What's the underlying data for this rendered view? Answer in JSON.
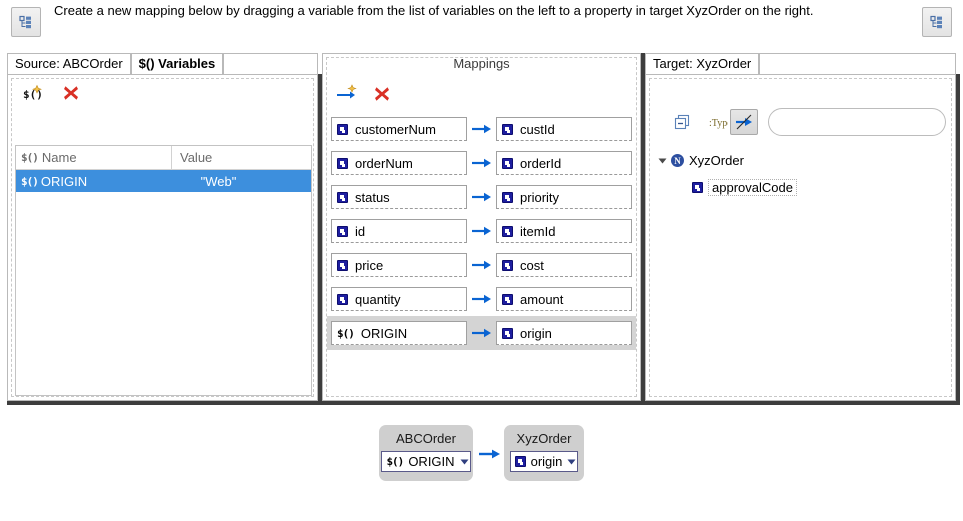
{
  "header": {
    "instruction": "Create a new mapping below by dragging a variable from the list of variables on the left to a property in target XyzOrder on the right.",
    "left_button_icon": "tree-outline-icon",
    "right_button_icon": "tree-outline-icon"
  },
  "source_panel": {
    "tabs": [
      {
        "label": "Source: ABCOrder",
        "active": false
      },
      {
        "label": "$() Variables",
        "active": true
      }
    ],
    "toolbar": {
      "add_variable_icon": "add-variable-icon",
      "delete_variable_icon": "delete-red-x-icon"
    },
    "table": {
      "columns": [
        "Name",
        "Value"
      ],
      "name_column_icon": "variable-icon",
      "rows": [
        {
          "icon": "variable-icon",
          "name": "ORIGIN",
          "value": "\"Web\"",
          "selected": true
        }
      ]
    }
  },
  "mappings_panel": {
    "title": "Mappings",
    "toolbar": {
      "add_mapping_icon": "add-mapping-arrow-icon",
      "delete_mapping_icon": "delete-red-x-icon"
    },
    "arrow_icon": "right-arrow-icon",
    "rows": [
      {
        "source_icon": "property-icon",
        "source": "customerNum",
        "target_icon": "property-icon",
        "target": "custId",
        "selected": false
      },
      {
        "source_icon": "property-icon",
        "source": "orderNum",
        "target_icon": "property-icon",
        "target": "orderId",
        "selected": false
      },
      {
        "source_icon": "property-icon",
        "source": "status",
        "target_icon": "property-icon",
        "target": "priority",
        "selected": false
      },
      {
        "source_icon": "property-icon",
        "source": "id",
        "target_icon": "property-icon",
        "target": "itemId",
        "selected": false
      },
      {
        "source_icon": "property-icon",
        "source": "price",
        "target_icon": "property-icon",
        "target": "cost",
        "selected": false
      },
      {
        "source_icon": "property-icon",
        "source": "quantity",
        "target_icon": "property-icon",
        "target": "amount",
        "selected": false
      },
      {
        "source_icon": "variable-icon",
        "source": "ORIGIN",
        "target_icon": "property-icon",
        "target": "origin",
        "selected": true
      }
    ]
  },
  "target_panel": {
    "tabs": [
      {
        "label": "Target: XyzOrder",
        "active": false
      }
    ],
    "toolbar": {
      "collapse_all_icon": "collapse-all-icon",
      "show_types_icon": "show-types-icon",
      "hide_mapped_icon": "hide-mapped-properties-icon",
      "hide_mapped_pressed": true
    },
    "search": {
      "value": "",
      "placeholder": "",
      "search_icon": "search-icon",
      "clear_icon": "clear-x-icon"
    },
    "tree": [
      {
        "icon": "class-icon",
        "icon_glyph": "N",
        "label": "XyzOrder",
        "expanded": true,
        "twisty": "chevron-down-icon"
      },
      {
        "icon": "property-icon",
        "label": "approvalCode",
        "child": true
      }
    ]
  },
  "diagram": {
    "source_node": {
      "title": "ABCOrder",
      "field_icon": "variable-icon",
      "field_label": "ORIGIN",
      "caret_icon": "chevron-down-icon"
    },
    "arrow_icon": "right-arrow-icon",
    "target_node": {
      "title": "XyzOrder",
      "field_icon": "property-icon",
      "field_label": "origin",
      "caret_icon": "chevron-down-icon"
    }
  },
  "colors": {
    "selection_blue": "#3d8fdd",
    "arrow_blue": "#0a64d2",
    "delete_red": "#d93025",
    "node_gray": "#cfcfcf",
    "row_selected_gray": "#d4d4d4"
  }
}
